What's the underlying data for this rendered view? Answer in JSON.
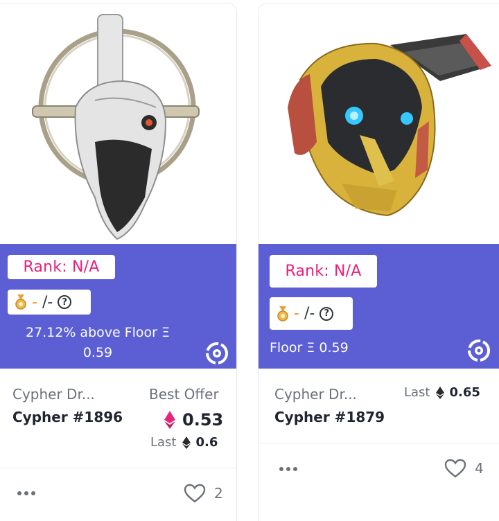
{
  "cards": [
    {
      "rank_label": "Rank: N/A",
      "badge_dash": "-",
      "badge_ratio": "/-",
      "floor_line1": "27.12% above Floor Ξ",
      "floor_line2": "0.59",
      "collection": "Cypher Dr...",
      "title": "Cypher #1896",
      "best_offer_label": "Best Offer",
      "best_offer_value": "0.53",
      "last_label": "Last",
      "last_value": "0.6",
      "likes": "2",
      "image_icon": "cypher-drone-white-helmet-image"
    },
    {
      "rank_label": "Rank: N/A",
      "badge_dash": "-",
      "badge_ratio": "/-",
      "floor_line1": "Floor Ξ 0.59",
      "collection": "Cypher Dr...",
      "title": "Cypher #1879",
      "last_label": "Last",
      "last_value": "0.65",
      "likes": "4",
      "image_icon": "cypher-drone-yellow-helmet-image"
    }
  ],
  "icons": {
    "medal": "medal-icon",
    "help": "question-circle-icon",
    "marketplace": "marketplace-logo-icon",
    "eth_pink": "ethereum-pink-icon",
    "eth_black": "ethereum-black-icon",
    "more": "more-dots-icon",
    "heart": "heart-icon"
  },
  "colors": {
    "panel": "#5b5fd3",
    "rank_text": "#e8207a",
    "eth_pink": "#e5267b"
  }
}
